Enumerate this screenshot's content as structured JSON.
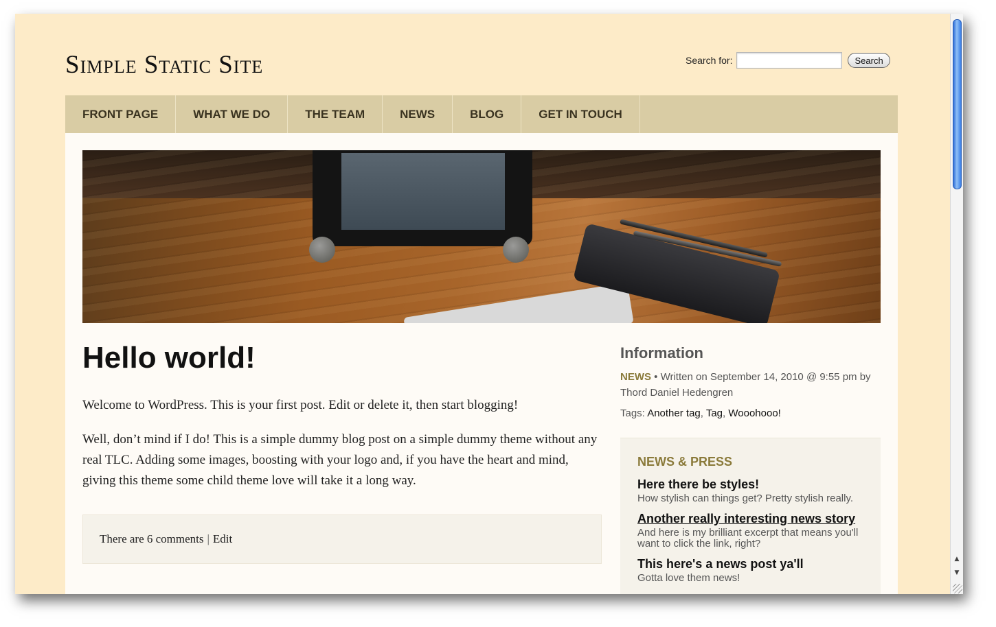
{
  "site": {
    "title": "Simple Static Site"
  },
  "search": {
    "label": "Search for:",
    "value": "",
    "button_label": "Search"
  },
  "nav": {
    "items": [
      "FRONT PAGE",
      "WHAT WE DO",
      "THE TEAM",
      "NEWS",
      "BLOG",
      "GET IN TOUCH"
    ]
  },
  "post": {
    "title": "Hello world!",
    "paragraphs": [
      "Welcome to WordPress. This is your first post. Edit or delete it, then start blogging!",
      "Well, don’t mind if I do! This is a simple dummy blog post on a simple dummy theme without any real TLC. Adding some images, boosting with your logo and, if you have the heart and mind, giving this theme some child theme love will take it a long way."
    ],
    "comments_label": "There are 6 comments",
    "separator": "|",
    "edit_label": "Edit"
  },
  "info": {
    "heading": "Information",
    "category": "NEWS",
    "meta_text": " • Written on September 14, 2010 @ 9:55 pm by Thord Daniel Hedengren",
    "tags_label": "Tags:",
    "tags": [
      "Another tag",
      "Tag",
      "Wooohooo!"
    ],
    "tag_separator": ","
  },
  "news_press": {
    "heading": "NEWS & PRESS",
    "items": [
      {
        "title": "Here there be styles!",
        "excerpt": "How stylish can things get? Pretty stylish really.",
        "underlined": false
      },
      {
        "title": "Another really interesting news story",
        "excerpt": "And here is my brilliant excerpt that means you'll want to click the link, right?",
        "underlined": true
      },
      {
        "title": "This here's a news post ya'll",
        "excerpt": "Gotta love them news!",
        "underlined": false
      }
    ]
  },
  "scrollbar": {
    "up_icon": "▲",
    "down_icon": "▼"
  },
  "colors": {
    "page_background": "#fdebc8",
    "nav_background": "#d9cca4",
    "content_background": "#fefbf6",
    "accent": "#8a7a3a"
  }
}
